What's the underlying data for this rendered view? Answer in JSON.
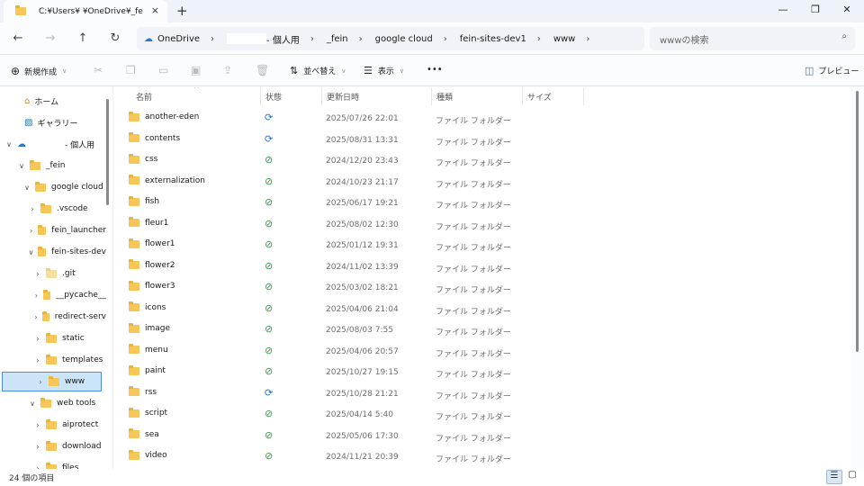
{
  "window": {
    "tab_title": "C:¥Users¥        ¥OneDrive¥_fe",
    "tab_close": "×",
    "new_tab": "+",
    "minimize": "—",
    "maximize": "❐",
    "close": "✕"
  },
  "nav": {
    "back": "←",
    "forward": "→",
    "up": "↑",
    "refresh": "↻"
  },
  "breadcrumb": [
    {
      "label": "OneDrive"
    },
    {
      "label": "- 個人用"
    },
    {
      "label": "_fein"
    },
    {
      "label": "google cloud"
    },
    {
      "label": "fein-sites-dev1"
    },
    {
      "label": "www"
    }
  ],
  "search": {
    "placeholder": "wwwの検索"
  },
  "toolbar": {
    "new_label": "新規作成",
    "sort_label": "並べ替え",
    "view_label": "表示",
    "more_label": "•••",
    "preview_label": "プレビュー"
  },
  "sidebar": {
    "items": [
      {
        "label": "ホーム",
        "depth": 0,
        "chevron": "",
        "icon": "home-icon"
      },
      {
        "label": "ギャラリー",
        "depth": 0,
        "chevron": "",
        "icon": "gallery-icon"
      },
      {
        "label": "- 個人用",
        "depth": 0,
        "chevron": "∨",
        "icon": "cloud-icon"
      },
      {
        "label": "_fein",
        "depth": 1,
        "chevron": "∨",
        "icon": "folder"
      },
      {
        "label": "google cloud",
        "depth": 2,
        "chevron": "∨",
        "icon": "folder"
      },
      {
        "label": ".vscode",
        "depth": 3,
        "chevron": "›",
        "icon": "folder"
      },
      {
        "label": "fein_launcher",
        "depth": 3,
        "chevron": "›",
        "icon": "folder"
      },
      {
        "label": "fein-sites-dev",
        "depth": 3,
        "chevron": "∨",
        "icon": "folder"
      },
      {
        "label": ".git",
        "depth": 4,
        "chevron": "›",
        "icon": "folder-light"
      },
      {
        "label": "__pycache__",
        "depth": 4,
        "chevron": "›",
        "icon": "folder"
      },
      {
        "label": "redirect-serv",
        "depth": 4,
        "chevron": "›",
        "icon": "folder"
      },
      {
        "label": "static",
        "depth": 4,
        "chevron": "›",
        "icon": "folder"
      },
      {
        "label": "templates",
        "depth": 4,
        "chevron": "›",
        "icon": "folder"
      },
      {
        "label": "www",
        "depth": 4,
        "chevron": "›",
        "icon": "folder",
        "selected": true
      },
      {
        "label": "web tools",
        "depth": 3,
        "chevron": "∨",
        "icon": "folder"
      },
      {
        "label": "aiprotect",
        "depth": 4,
        "chevron": "›",
        "icon": "folder"
      },
      {
        "label": "download",
        "depth": 4,
        "chevron": "›",
        "icon": "folder"
      },
      {
        "label": "files",
        "depth": 4,
        "chevron": "›",
        "icon": "folder"
      }
    ]
  },
  "columns": {
    "name": "名前",
    "status": "状態",
    "modified": "更新日時",
    "type": "種類",
    "size": "サイズ",
    "sort_indicator": "^"
  },
  "files": [
    {
      "name": "another-eden",
      "status": "sync",
      "modified": "2025/07/26 22:01",
      "type": "ファイル フォルダー"
    },
    {
      "name": "contents",
      "status": "sync",
      "modified": "2025/08/31 13:31",
      "type": "ファイル フォルダー"
    },
    {
      "name": "css",
      "status": "ok",
      "modified": "2024/12/20 23:43",
      "type": "ファイル フォルダー"
    },
    {
      "name": "externalization",
      "status": "ok",
      "modified": "2024/10/23 21:17",
      "type": "ファイル フォルダー"
    },
    {
      "name": "fish",
      "status": "ok",
      "modified": "2025/06/17 19:21",
      "type": "ファイル フォルダー"
    },
    {
      "name": "fleur1",
      "status": "ok",
      "modified": "2025/08/02 12:30",
      "type": "ファイル フォルダー"
    },
    {
      "name": "flower1",
      "status": "ok",
      "modified": "2025/01/12 19:31",
      "type": "ファイル フォルダー"
    },
    {
      "name": "flower2",
      "status": "ok",
      "modified": "2024/11/02 13:39",
      "type": "ファイル フォルダー"
    },
    {
      "name": "flower3",
      "status": "ok",
      "modified": "2025/03/02 18:21",
      "type": "ファイル フォルダー"
    },
    {
      "name": "icons",
      "status": "ok",
      "modified": "2025/04/06 21:04",
      "type": "ファイル フォルダー"
    },
    {
      "name": "image",
      "status": "ok",
      "modified": "2025/08/03 7:55",
      "type": "ファイル フォルダー"
    },
    {
      "name": "menu",
      "status": "ok",
      "modified": "2025/04/06 20:57",
      "type": "ファイル フォルダー"
    },
    {
      "name": "paint",
      "status": "ok",
      "modified": "2025/10/27 19:15",
      "type": "ファイル フォルダー"
    },
    {
      "name": "rss",
      "status": "sync",
      "modified": "2025/10/28 21:21",
      "type": "ファイル フォルダー"
    },
    {
      "name": "script",
      "status": "ok",
      "modified": "2025/04/14 5:40",
      "type": "ファイル フォルダー"
    },
    {
      "name": "sea",
      "status": "ok",
      "modified": "2025/05/06 17:30",
      "type": "ファイル フォルダー"
    },
    {
      "name": "video",
      "status": "ok",
      "modified": "2024/11/21 20:39",
      "type": "ファイル フォルダー"
    }
  ],
  "status_symbols": {
    "ok": "⊘",
    "sync": "⟳"
  },
  "statusbar": {
    "item_count": "24 個の項目"
  },
  "colors": {
    "folder": "#f6c758",
    "selected": "#cce4f7",
    "ok": "#2f9e44",
    "sync": "#1f7ad4"
  }
}
